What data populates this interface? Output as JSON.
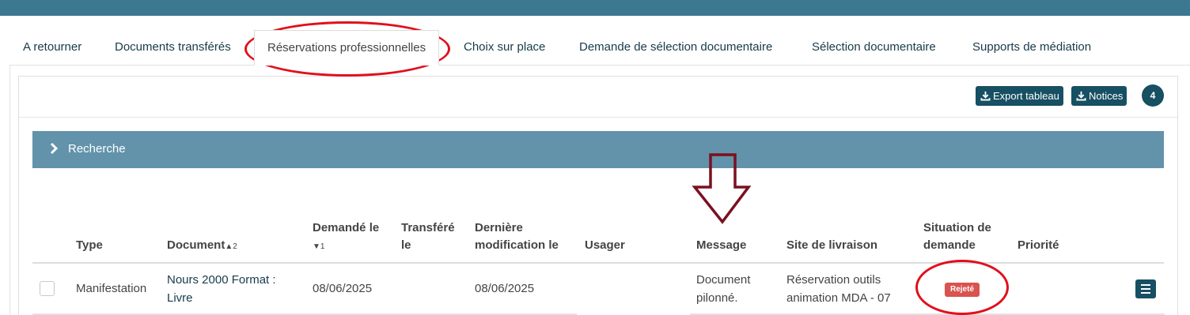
{
  "tabs": [
    {
      "label": "A retourner"
    },
    {
      "label": "Documents transférés"
    },
    {
      "label": "Réservations professionnelles"
    },
    {
      "label": "Choix sur place"
    },
    {
      "label": "Demande de sélection documentaire"
    },
    {
      "label": "Sélection documentaire"
    },
    {
      "label": "Supports de médiation"
    }
  ],
  "toolbar": {
    "export_label": "Export tableau",
    "notices_label": "Notices",
    "count": "4"
  },
  "search": {
    "label": "Recherche"
  },
  "table": {
    "headers": {
      "type": "Type",
      "document": "Document",
      "document_sort": "2",
      "demande_le_1": "Demandé le",
      "demande_sort": "1",
      "transfere_1": "Transféré",
      "transfere_2": "le",
      "derniere_1": "Dernière",
      "derniere_2": "modification le",
      "usager": "Usager",
      "message": "Message",
      "site": "Site de livraison",
      "situation_1": "Situation de",
      "situation_2": "demande",
      "priorite": "Priorité"
    },
    "rows": [
      {
        "type": "Manifestation",
        "document_1": "Nours 2000 Format :",
        "document_2": "Livre",
        "demande_le": "08/06/2025",
        "transfere_le": "",
        "derniere_modification": "08/06/2025",
        "usager": "",
        "message_1": "Document",
        "message_2": "pilonné.",
        "site_1": "Réservation outils",
        "site_2": "animation MDA - 07",
        "situation": "Rejeté",
        "priorite": ""
      }
    ]
  },
  "colors": {
    "header_bar": "#3d7891",
    "search_bar": "#6293ab",
    "button": "#174f63",
    "rejected_badge": "#d9534f",
    "annotation": "#e0101c",
    "arrow": "#7b1020"
  },
  "icons": [
    "download-icon",
    "chevron-right-icon",
    "menu-icon",
    "down-arrow-annotation"
  ]
}
